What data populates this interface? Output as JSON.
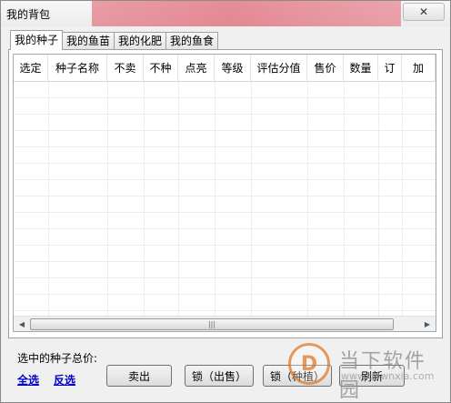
{
  "window": {
    "title": "我的背包",
    "close_glyph": "✕",
    "accent_color": "#d9374a"
  },
  "tabs": [
    {
      "label": "我的种子",
      "active": true
    },
    {
      "label": "我的鱼苗",
      "active": false
    },
    {
      "label": "我的化肥",
      "active": false
    },
    {
      "label": "我的鱼食",
      "active": false
    }
  ],
  "table": {
    "columns": [
      "选定",
      "种子名称",
      "不卖",
      "不种",
      "点亮",
      "等级",
      "评估分值",
      "售价",
      "数量",
      "订",
      "加"
    ],
    "rows": []
  },
  "scrollbar": {
    "left_arrow": "◀",
    "right_arrow": "▶",
    "thumb_grip": "|||"
  },
  "footer": {
    "total_label": "选中的种子总价:",
    "select_all": "全选",
    "invert_select": "反选",
    "sell_button": "卖出",
    "lock_sell_button": "锁（出售）",
    "lock_plant_button": "锁（种植）",
    "refresh_button": "刷新"
  },
  "watermark": {
    "logo_glyph": "D",
    "text": "当下软件园",
    "url": "www.downxia.com"
  }
}
